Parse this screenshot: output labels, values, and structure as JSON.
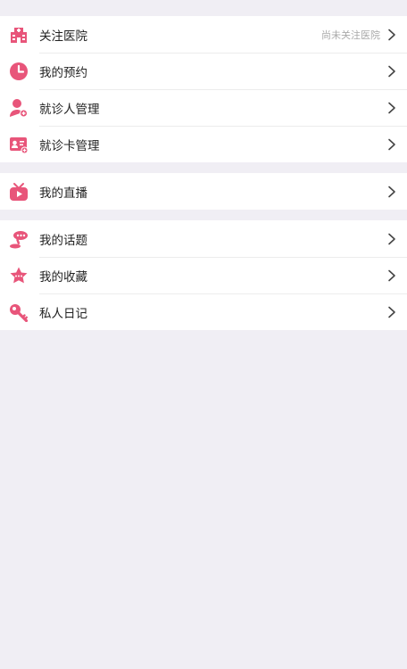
{
  "colors": {
    "accent": "#e8557a",
    "background": "#f0eef4",
    "text": "#222222",
    "hint": "#a9a9a9"
  },
  "groups": [
    {
      "items": [
        {
          "icon": "hospital-icon",
          "label": "关注医院",
          "hint": "尚未关注医院"
        },
        {
          "icon": "clock-icon",
          "label": "我的预约"
        },
        {
          "icon": "patient-icon",
          "label": "就诊人管理"
        },
        {
          "icon": "card-icon",
          "label": "就诊卡管理"
        }
      ]
    },
    {
      "items": [
        {
          "icon": "tv-icon",
          "label": "我的直播"
        }
      ]
    },
    {
      "items": [
        {
          "icon": "topic-icon",
          "label": "我的话题"
        },
        {
          "icon": "star-icon",
          "label": "我的收藏"
        },
        {
          "icon": "key-icon",
          "label": "私人日记"
        }
      ]
    }
  ]
}
